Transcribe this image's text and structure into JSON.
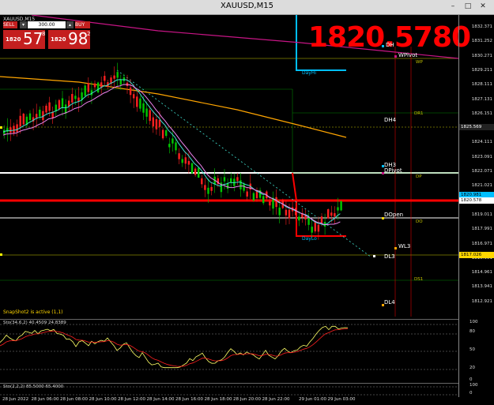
{
  "window": {
    "title": "XAUUSD,M15",
    "min_label": "–",
    "max_label": "□",
    "close_label": "✕"
  },
  "chart": {
    "symbol_label": "XAUUSD,M15",
    "big_price": "1820.5780",
    "snapshot_text": "SnapShot2 is active (1,1)"
  },
  "trade_panel": {
    "sell_label": "SELL",
    "buy_label": "BUY",
    "volume": "300.00",
    "sell_prefix": "1820",
    "sell_big": "57",
    "sell_sup": "8",
    "buy_prefix": "1820",
    "buy_big": "98",
    "buy_sup": "2"
  },
  "price_axis": [
    "1832.371",
    "1831.252",
    "1830.271",
    "1829.211",
    "1828.111",
    "1827.131",
    "1826.151",
    "1825.131",
    "1824.111",
    "1823.091",
    "1822.071",
    "1821.021",
    "1820.031",
    "1819.011",
    "1817.991",
    "1816.971",
    "1815.951",
    "1814.961",
    "1813.941",
    "1812.921"
  ],
  "price_tags": [
    {
      "text": "1825.569",
      "color": "#ffffff",
      "bg": "#222"
    },
    {
      "text": "1820.981",
      "color": "#000000",
      "bg": "#00bfff"
    },
    {
      "text": "1820.578",
      "color": "#000000",
      "bg": "#ffffff"
    },
    {
      "text": "1817.026",
      "color": "#000000",
      "bg": "#ffd700"
    }
  ],
  "levels": {
    "dayhi": "DayHi",
    "daylo": "DayLo",
    "dh": "DH",
    "wpivot": "WPivot",
    "wp": "WP",
    "dr1": "DR1",
    "dh4": "DH4",
    "dh3": "DH3",
    "dpivot": "DPivot",
    "dp": "DP",
    "dopen": "DOpen",
    "do": "DO",
    "wl3": "WL3",
    "dl3": "DL3",
    "ds1": "DS1",
    "dl4": "DL4"
  },
  "stoch": {
    "label": "Sto(34,6,2) 40.4509 24.8389",
    "ticks": [
      "100",
      "80",
      "50",
      "20",
      "0"
    ]
  },
  "stoch2": {
    "label": "Sto(2,2,2) 85.5000 65.4000",
    "ticks": [
      "100",
      "0"
    ]
  },
  "time_axis": [
    "28 Jun 2022",
    "28 Jun 06:00",
    "28 Jun 08:00",
    "28 Jun 10:00",
    "28 Jun 12:00",
    "28 Jun 14:00",
    "28 Jun 16:00",
    "28 Jun 18:00",
    "28 Jun 20:00",
    "28 Jun 22:00",
    "29 Jun 01:00",
    "29 Jun 03:00"
  ],
  "colors": {
    "bull": "#00c800",
    "bear": "#ff2020",
    "ma_fast": "#40e0d0",
    "ma_slow": "#ffa500",
    "ma_mid": "#ee82ee",
    "dayhi": "#00bfff",
    "dayrange": "#ff0000",
    "magenta": "#c71585"
  }
}
